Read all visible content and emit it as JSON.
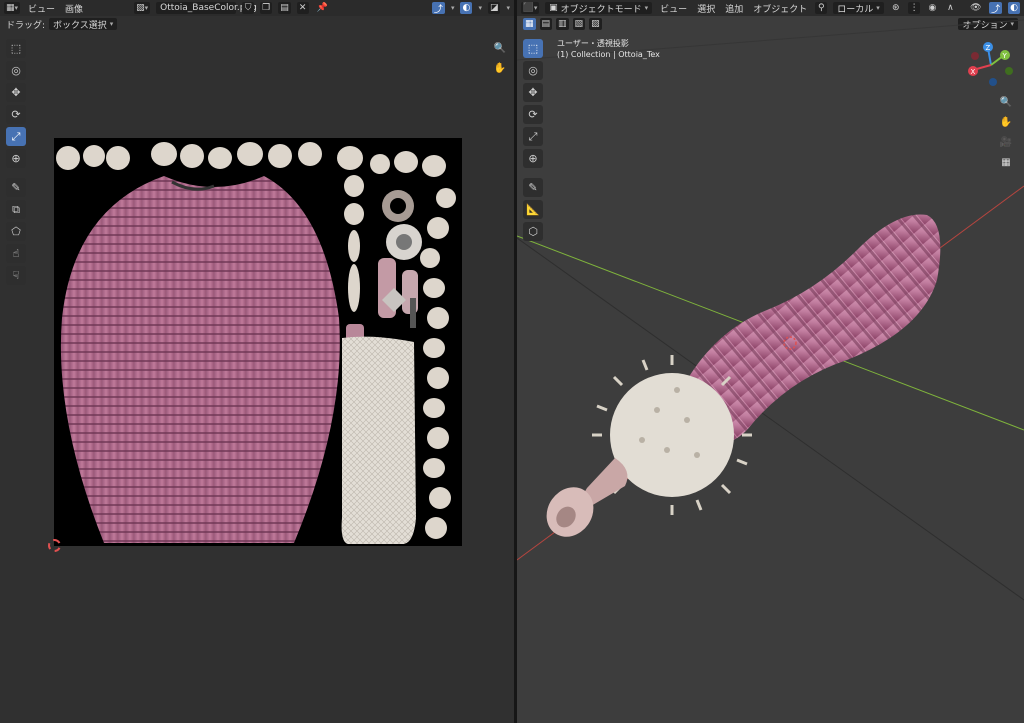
{
  "uv_editor": {
    "header": {
      "editor_type_icon": "uv-editor-icon",
      "menus": [
        "ビュー",
        "画像"
      ],
      "image_name": "Ottoia_BaseColor.png"
    },
    "subheader": {
      "drag_label": "ドラッグ:",
      "drag_mode": "ボックス選択"
    },
    "tools": [
      {
        "name": "select-box-tool",
        "glyph": "⬚",
        "active": false
      },
      {
        "name": "cursor-tool",
        "glyph": "◎",
        "active": false
      },
      {
        "name": "move-tool",
        "glyph": "✥",
        "active": false
      },
      {
        "name": "rotate-tool",
        "glyph": "⟳",
        "active": false
      },
      {
        "name": "scale-tool",
        "glyph": "⤢",
        "active": true
      },
      {
        "name": "transform-tool",
        "glyph": "⊕",
        "active": false
      },
      {
        "name": "annotate-tool",
        "glyph": "✎",
        "active": false
      },
      {
        "name": "rip-tool",
        "glyph": "⧉",
        "active": false
      },
      {
        "name": "grab-tool",
        "glyph": "⬠",
        "active": false
      },
      {
        "name": "relax-tool",
        "glyph": "☝",
        "active": false
      },
      {
        "name": "pinch-tool",
        "glyph": "☟",
        "active": false
      }
    ]
  },
  "viewport": {
    "header": {
      "mode": "オブジェクトモード",
      "menus": [
        "ビュー",
        "選択",
        "追加",
        "オブジェクト"
      ],
      "orientation": "ローカル"
    },
    "subheader": {
      "options_label": "オプション"
    },
    "overlay": {
      "view_name": "ユーザー・透視投影",
      "collection_info": "(1) Collection | Ottoia_Tex"
    },
    "tools": [
      {
        "name": "select-box-tool",
        "glyph": "⬚",
        "active": true
      },
      {
        "name": "cursor-tool",
        "glyph": "◎",
        "active": false
      },
      {
        "name": "move-tool",
        "glyph": "✥",
        "active": false
      },
      {
        "name": "rotate-tool",
        "glyph": "⟳",
        "active": false
      },
      {
        "name": "scale-tool",
        "glyph": "⤢",
        "active": false
      },
      {
        "name": "transform-tool",
        "glyph": "⊕",
        "active": false
      },
      {
        "name": "annotate-tool",
        "glyph": "✎",
        "active": false
      },
      {
        "name": "measure-tool",
        "glyph": "📐",
        "active": false
      },
      {
        "name": "add-cube-tool",
        "glyph": "⬡",
        "active": false
      }
    ],
    "gizmo_axes": [
      "X",
      "Y",
      "Z"
    ]
  },
  "colors": {
    "accent": "#4772b3",
    "x_axis": "#e0404f",
    "y_axis": "#80c040",
    "z_axis": "#3b8fe6",
    "body_pink": "#b86f94",
    "spines_white": "#e6e1d8"
  }
}
